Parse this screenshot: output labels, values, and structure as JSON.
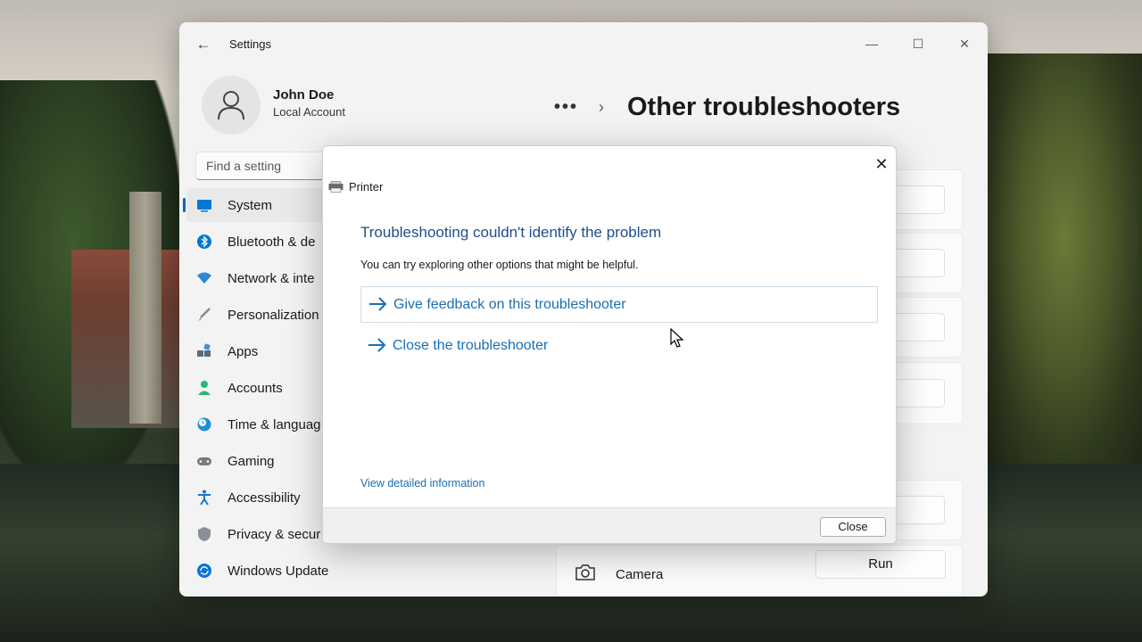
{
  "window": {
    "app_title": "Settings",
    "back_icon": "←",
    "minimize_icon": "—",
    "maximize_icon": "☐",
    "close_icon": "✕"
  },
  "user": {
    "name": "John Doe",
    "account_type": "Local Account"
  },
  "breadcrumb": {
    "more": "•••",
    "chevron": "›",
    "title": "Other troubleshooters"
  },
  "search": {
    "placeholder": "Find a setting"
  },
  "nav": {
    "items": [
      {
        "label": "System",
        "icon": "monitor-icon",
        "color": "#0078d4"
      },
      {
        "label": "Bluetooth & de",
        "icon": "bluetooth-icon",
        "color": "#0078d4"
      },
      {
        "label": "Network & inte",
        "icon": "wifi-icon",
        "color": "#2b88d8"
      },
      {
        "label": "Personalization",
        "icon": "brush-icon",
        "color": "#e08a2e"
      },
      {
        "label": "Apps",
        "icon": "apps-icon",
        "color": "#5a6b7d"
      },
      {
        "label": "Accounts",
        "icon": "person-icon",
        "color": "#2bb673"
      },
      {
        "label": "Time & languag",
        "icon": "globe-clock-icon",
        "color": "#1e90d6"
      },
      {
        "label": "Gaming",
        "icon": "gamepad-icon",
        "color": "#7a7a7a"
      },
      {
        "label": "Accessibility",
        "icon": "accessibility-icon",
        "color": "#1a73c9"
      },
      {
        "label": "Privacy & secur",
        "icon": "shield-icon",
        "color": "#8a8f98"
      },
      {
        "label": "Windows Update",
        "icon": "update-icon",
        "color": "#0b74d4"
      }
    ]
  },
  "camera": {
    "label": "Camera",
    "run_label": "Run"
  },
  "dialog": {
    "app_title": "Printer",
    "close_icon": "✕",
    "heading": "Troubleshooting couldn't identify the problem",
    "description": "You can try exploring other options that might be helpful.",
    "options": [
      {
        "label": "Give feedback on this troubleshooter"
      },
      {
        "label": "Close the troubleshooter"
      }
    ],
    "detail_link": "View detailed information",
    "close_button": "Close"
  }
}
